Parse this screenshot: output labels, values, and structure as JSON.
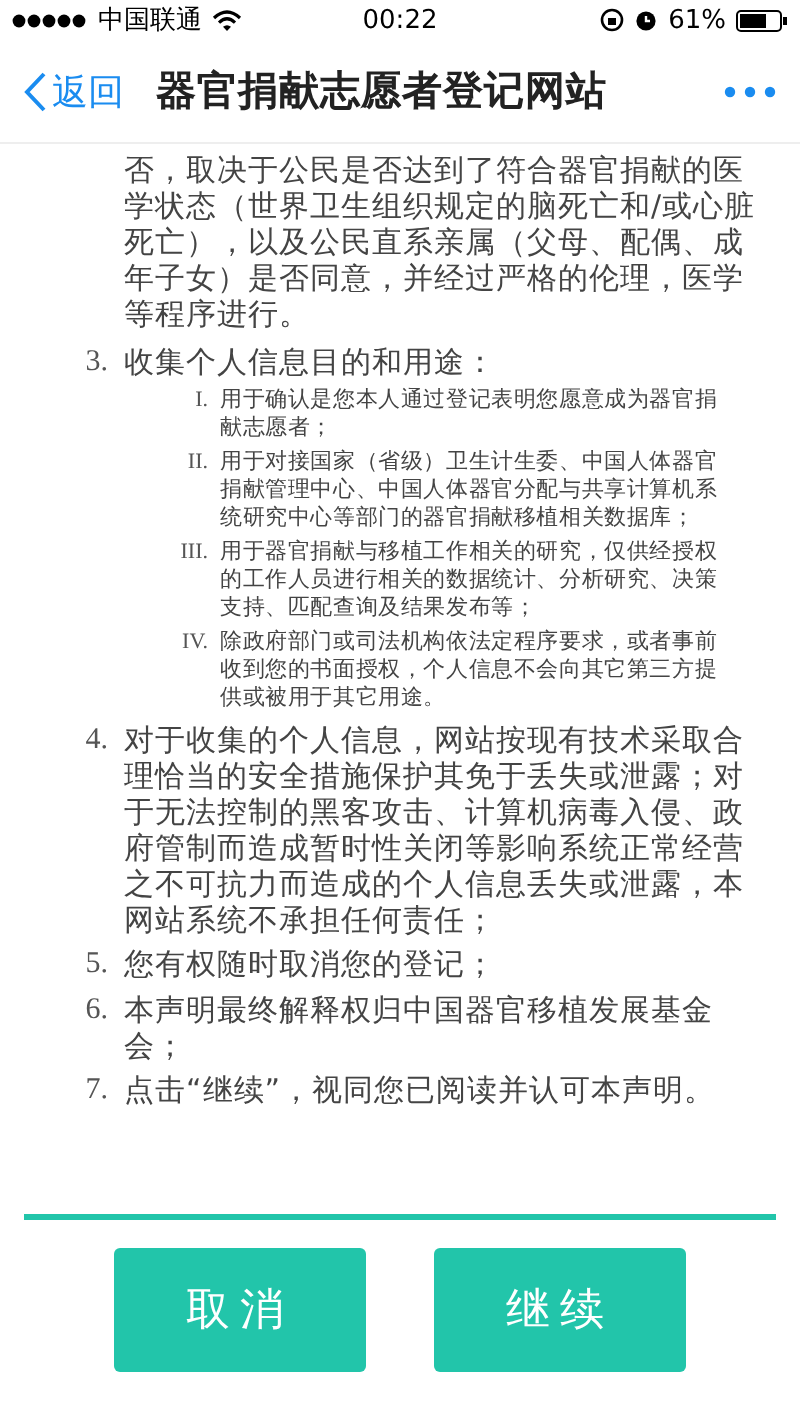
{
  "status_bar": {
    "carrier": "中国联通",
    "time": "00:22",
    "battery": "61%"
  },
  "nav": {
    "back_label": "返回",
    "title": "器官捐献志愿者登记网站"
  },
  "content": {
    "continuation": "否，取决于公民是否达到了符合器官捐献的医学状态（世界卫生组织规定的脑死亡和/或心脏死亡），以及公民直系亲属（父母、配偶、成年子女）是否同意，并经过严格的伦理，医学等程序进行。",
    "items": [
      {
        "number": "3.",
        "text": "收集个人信息目的和用途：",
        "sub_items": [
          {
            "number": "I.",
            "text": "用于确认是您本人通过登记表明您愿意成为器官捐献志愿者；"
          },
          {
            "number": "II.",
            "text": "用于对接国家（省级）卫生计生委、中国人体器官捐献管理中心、中国人体器官分配与共享计算机系统研究中心等部门的器官捐献移植相关数据库；"
          },
          {
            "number": "III.",
            "text": "用于器官捐献与移植工作相关的研究，仅供经授权的工作人员进行相关的数据统计、分析研究、决策支持、匹配查询及结果发布等；"
          },
          {
            "number": "IV.",
            "text": "除政府部门或司法机构依法定程序要求，或者事前收到您的书面授权，个人信息不会向其它第三方提供或被用于其它用途。"
          }
        ]
      },
      {
        "number": "4.",
        "text": "对于收集的个人信息，网站按现有技术采取合理恰当的安全措施保护其免于丢失或泄露；对于无法控制的黑客攻击、计算机病毒入侵、政府管制而造成暂时性关闭等影响系统正常经营之不可抗力而造成的个人信息丢失或泄露，本网站系统不承担任何责任；"
      },
      {
        "number": "5.",
        "text": "您有权随时取消您的登记；"
      },
      {
        "number": "6.",
        "text": "本声明最终解释权归中国器官移植发展基金会；"
      },
      {
        "number": "7.",
        "text": "点击“继续”，视同您已阅读并认可本声明。"
      }
    ]
  },
  "buttons": [
    {
      "label": "取消"
    },
    {
      "label": "继续"
    }
  ]
}
